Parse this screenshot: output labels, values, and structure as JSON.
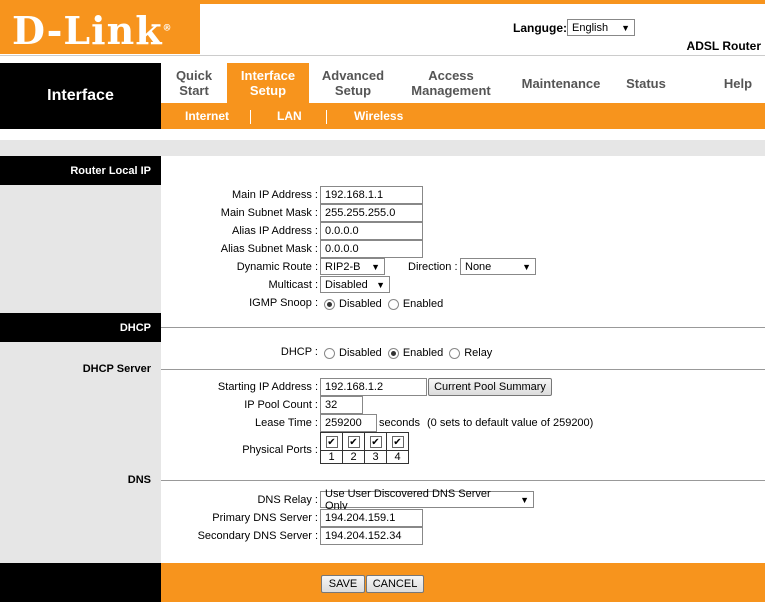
{
  "header": {
    "logo": "D-Link",
    "logo_reg": "®",
    "language_label": "Languge:",
    "language_value": "English",
    "model": "ADSL Router"
  },
  "nav": {
    "section_title": "Interface",
    "tabs": [
      {
        "line1": "Quick",
        "line2": "Start"
      },
      {
        "line1": "Interface",
        "line2": "Setup"
      },
      {
        "line1": "Advanced",
        "line2": "Setup"
      },
      {
        "line1": "Access",
        "line2": "Management"
      },
      {
        "line1": "Maintenance",
        "line2": ""
      },
      {
        "line1": "Status",
        "line2": ""
      },
      {
        "line1": "Help",
        "line2": ""
      }
    ],
    "active_tab": "Interface Setup",
    "subtabs": [
      "Internet",
      "LAN",
      "Wireless"
    ]
  },
  "sections": {
    "router_local_ip": "Router Local IP",
    "dhcp": "DHCP",
    "dhcp_server": "DHCP Server",
    "dns": "DNS"
  },
  "router": {
    "main_ip_label": "Main IP Address :",
    "main_ip": "192.168.1.1",
    "main_mask_label": "Main Subnet Mask :",
    "main_mask": "255.255.255.0",
    "alias_ip_label": "Alias IP Address :",
    "alias_ip": "0.0.0.0",
    "alias_mask_label": "Alias Subnet Mask :",
    "alias_mask": "0.0.0.0",
    "dynamic_route_label": "Dynamic Route :",
    "dynamic_route": "RIP2-B",
    "direction_label": "Direction :",
    "direction": "None",
    "multicast_label": "Multicast :",
    "multicast": "Disabled",
    "igmp_label": "IGMP Snoop :",
    "igmp_disabled": "Disabled",
    "igmp_enabled": "Enabled",
    "igmp_selected": "Disabled"
  },
  "dhcp": {
    "dhcp_label": "DHCP :",
    "opt_disabled": "Disabled",
    "opt_enabled": "Enabled",
    "opt_relay": "Relay",
    "selected": "Enabled",
    "start_ip_label": "Starting IP Address :",
    "start_ip": "192.168.1.2",
    "pool_button": "Current Pool Summary",
    "pool_count_label": "IP Pool Count :",
    "pool_count": "32",
    "lease_label": "Lease Time :",
    "lease": "259200",
    "lease_unit": "seconds",
    "lease_hint": "(0 sets to default value of 259200)",
    "ports_label": "Physical Ports :",
    "ports": [
      {
        "num": "1",
        "checked": true
      },
      {
        "num": "2",
        "checked": true
      },
      {
        "num": "3",
        "checked": true
      },
      {
        "num": "4",
        "checked": true
      }
    ]
  },
  "dns": {
    "relay_label": "DNS Relay :",
    "relay": "Use User Discovered DNS Server Only",
    "primary_label": "Primary DNS Server :",
    "primary": "194.204.159.1",
    "secondary_label": "Secondary DNS Server :",
    "secondary": "194.204.152.34"
  },
  "footer": {
    "save": "SAVE",
    "cancel": "CANCEL"
  },
  "colors": {
    "accent": "#f7941d",
    "dark": "#000000",
    "panel": "#e6e6e6"
  }
}
